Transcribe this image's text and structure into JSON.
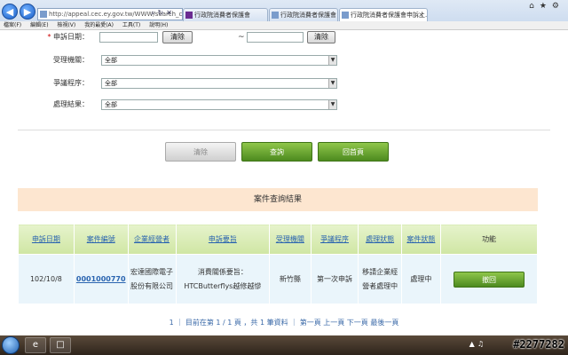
{
  "browser": {
    "address": "http://appeal.cec.ey.gov.tw/WWW/search_case_l",
    "tabs": [
      {
        "label": "行政院消費者保護會",
        "active": false
      },
      {
        "label": "行政院消費者保護會",
        "active": false
      },
      {
        "label": "行政院消費者保護會申訴上...",
        "active": true
      }
    ],
    "menu": [
      "檔案(F)",
      "編輯(E)",
      "檢視(V)",
      "我的最愛(A)",
      "工具(T)",
      "說明(H)"
    ]
  },
  "form": {
    "date_label": "申訴日期：",
    "date_required_mark": "*",
    "clear_label": "清除",
    "tilde": "~",
    "agency_label": "受理機關：",
    "procedure_label": "爭議程序：",
    "result_label": "處理結果：",
    "select_value": "全部"
  },
  "buttons": {
    "clear": "清除",
    "search": "查詢",
    "home": "回首頁"
  },
  "results": {
    "title": "案件查詢結果",
    "headers": [
      "申訴日期",
      "案件編號",
      "企業經營者",
      "申訴要旨",
      "受理機關",
      "爭議程序",
      "處理狀態",
      "案件狀態",
      "功能"
    ],
    "rows": [
      {
        "date": "102/10/8",
        "case_no": "0001000770",
        "company": "宏達國際電子股份有限公司",
        "summary": "消費關係要旨：HTCButterflys越修越慘",
        "agency": "新竹縣",
        "procedure": "第一次申訴",
        "process_status": "移請企業經營者處理中",
        "case_status": "處理中",
        "action": "撤回"
      }
    ]
  },
  "pager": {
    "text": "1 ｜ 目前在第 1 / 1 頁 ，共 1 筆資料 ｜ 第一頁  上一頁  下一頁  最後一頁"
  },
  "watermark": "#2277282"
}
